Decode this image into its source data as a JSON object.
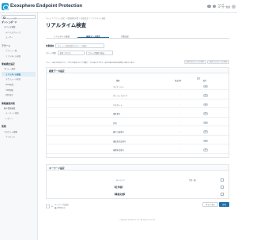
{
  "header": {
    "brand": "Exosphere Endpoint Protection",
    "user_name": "ヘルプ",
    "user_sub": "ユーザー管理"
  },
  "sidebar": {
    "search_placeholder": "メニュー検索",
    "sections": [
      {
        "title": "ダッシュボード",
        "items": [
          {
            "label": "デバイス管理",
            "sub": false,
            "active": false
          },
          {
            "label": "デバイスグループ",
            "sub": true,
            "active": false
          },
          {
            "label": "ユーザー",
            "sub": true,
            "active": false
          }
        ]
      },
      {
        "title": "アラート",
        "items": [
          {
            "label": "アラート一覧",
            "sub": true,
            "active": false
          },
          {
            "label": "リアルタイム検査",
            "sub": true,
            "active": false
          }
        ]
      },
      {
        "title": "脅威検出設定",
        "items": [
          {
            "label": "ポリシー設定",
            "sub": false,
            "active": false
          },
          {
            "label": "リアルタイム検査",
            "sub": true,
            "active": true
          },
          {
            "label": "スケジュール検査",
            "sub": true,
            "active": false
          },
          {
            "label": "Web保護",
            "sub": true,
            "active": false
          },
          {
            "label": "USB制御",
            "sub": true,
            "active": false
          },
          {
            "label": "例外設定",
            "sub": true,
            "active": false
          }
        ]
      },
      {
        "title": "情報漏洩対策",
        "items": [
          {
            "label": "個人情報検査",
            "sub": false,
            "active": false
          },
          {
            "label": "キーワード検査",
            "sub": true,
            "active": false
          },
          {
            "label": "レポート",
            "sub": true,
            "active": false
          }
        ]
      },
      {
        "title": "管理",
        "items": [
          {
            "label": "アカウント管理",
            "sub": false,
            "active": false
          },
          {
            "label": "ライセンス",
            "sub": true,
            "active": false
          }
        ]
      }
    ]
  },
  "main": {
    "breadcrumb": "ホーム > ポリシー設定 > 情報漏洩対策 > 検査設定 > リアルタイム検査",
    "title": "リアルタイム検査",
    "tabs": [
      "リアルタイム検査",
      "検査データ設定",
      "対策設定"
    ],
    "active_tab": 1,
    "toolbar": {
      "policy_label": "対象端末",
      "policy_placeholder": "ポリシーや検索条件のグループ検索",
      "group_label": "グループ選択",
      "group_value": "全体（すべて）",
      "group_filter": "グループ選択で絞込"
    },
    "note": "ポリシー設定が有効なグループまたは端末に対して検査データを設定できます。設定内容は次回の同期時に反映されます。",
    "note_buttons": [
      "選択中のグループに適用",
      "選択したグループに適用"
    ],
    "detect_section": {
      "title": "検査データ設定",
      "col_type": "種類",
      "col_setting": "設定",
      "col_rule": "検出条件",
      "col_action": "動作",
      "rows": [
        {
          "name": "マイナンバー",
          "value": "-",
          "state": "ON"
        },
        {
          "name": "クレジットカード",
          "value": "-",
          "state": "ON"
        },
        {
          "name": "パスポート",
          "value": "-",
          "state": "ON"
        },
        {
          "name": "電話番号",
          "value": "-",
          "state": "ON"
        },
        {
          "name": "住所",
          "value": "-",
          "state": "ON"
        },
        {
          "name": "銀行口座番号",
          "value": "-",
          "state": "ON"
        },
        {
          "name": "運転免許証番号",
          "value": "-",
          "state": "ON"
        },
        {
          "name": "基礎年金番号",
          "value": "-",
          "state": "ON"
        }
      ]
    },
    "keyword_section": {
      "title": "キーワード設定",
      "col_keyword": "キーワード",
      "col_match": "完全一致",
      "rows": [
        {
          "keyword": "【社外秘】"
        },
        {
          "keyword": "【極秘文書】"
        }
      ]
    },
    "add_label": "キーワードを追加",
    "add_hint": "最大50件まで",
    "buttons": {
      "save": "保存",
      "cancel": "キャンセル"
    },
    "footer": "Copyright Exosphere, Inc. All rights reserved."
  }
}
